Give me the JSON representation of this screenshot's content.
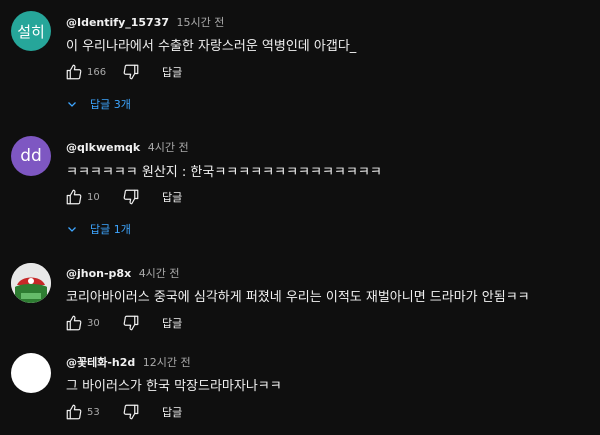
{
  "colors": {
    "background": "#0f0f0f",
    "link_blue": "#3ea6ff",
    "avatar1": "#26a69a",
    "avatar2": "#7e57c2"
  },
  "icons": {
    "like": "thumbs-up-icon",
    "dislike": "thumbs-down-icon",
    "replies": "chevron-down-icon"
  },
  "comments": [
    {
      "avatar_text": "설히",
      "handle": "@Identify_15737",
      "time": "15시간 전",
      "text": "이 우리나라에서 수출한 자랑스러운 역병인데 아갭다_",
      "likes": "166",
      "reply_label": "답글",
      "replies_label": "답글 3개"
    },
    {
      "avatar_text": "dd",
      "handle": "@qlkwemqk",
      "time": "4시간 전",
      "text": "ㅋㅋㅋㅋㅋㅋ 원산지 : 한국ㅋㅋㅋㅋㅋㅋㅋㅋㅋㅋㅋㅋㅋㅋ",
      "likes": "10",
      "reply_label": "답글",
      "replies_label": "답글 1개"
    },
    {
      "avatar_text": "",
      "handle": "@jhon-p8x",
      "time": "4시간 전",
      "text": "코리아바이러스 중국에 심각하게 퍼졌네 우리는 이적도 재벌아니면 드라마가 안됨ㅋㅋ",
      "likes": "30",
      "reply_label": "답글"
    },
    {
      "avatar_text": "",
      "handle": "@꽃테화-h2d",
      "time": "12시간 전",
      "text": "그 바이러스가 한국 막장드라마자나ㅋㅋ",
      "likes": "53",
      "reply_label": "답글"
    }
  ]
}
